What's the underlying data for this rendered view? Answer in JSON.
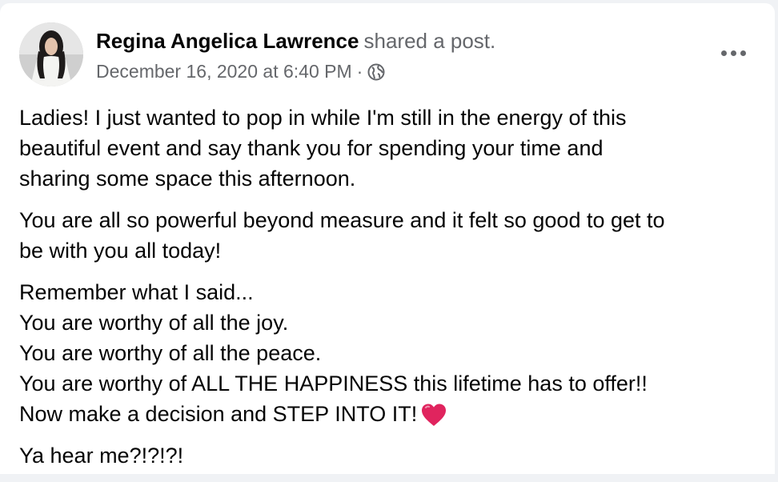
{
  "post": {
    "author": "Regina Angelica Lawrence",
    "action": "shared a post.",
    "timestamp": "December 16, 2020 at 6:40 PM",
    "separator": "·",
    "privacy_icon": "globe-icon",
    "menu_icon": "more-options-icon",
    "paragraphs": [
      {
        "lines": [
          "Ladies!  I just wanted to pop in while I'm still in the energy of this",
          "beautiful event and say thank you for spending your time and",
          "sharing some space this afternoon."
        ]
      },
      {
        "lines": [
          "You are all so powerful beyond measure and it felt so good to get to",
          "be with you all today!"
        ]
      },
      {
        "lines": [
          "Remember what I said...",
          "You are worthy of all the joy.",
          "You are worthy of all the peace.",
          "You are worthy of ALL THE HAPPINESS this lifetime has to offer!!",
          "Now make a decision and STEP INTO IT!"
        ],
        "trailing_emoji": "heart-emoji"
      },
      {
        "lines": [
          "Ya hear me?!?!?!"
        ]
      }
    ]
  },
  "colors": {
    "text_primary": "#050505",
    "text_secondary": "#65676b",
    "heart": "#e0245e",
    "page_background": "#f0f2f5",
    "card_background": "#ffffff"
  }
}
